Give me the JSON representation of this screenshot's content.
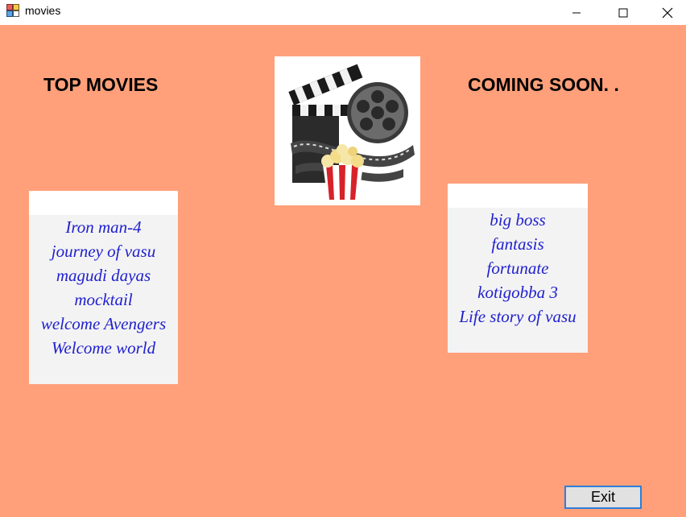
{
  "window": {
    "title": "movies",
    "icon": "app-window-icon",
    "controls": [
      "minimize-icon",
      "maximize-icon",
      "close-icon"
    ]
  },
  "headings": {
    "top_movies": "TOP MOVIES",
    "coming_soon": "COMING SOON. ."
  },
  "poster": {
    "icon": "movie-clapperboard-popcorn-icon"
  },
  "top_movies_list": {
    "items": [
      "Iron man-4",
      "journey of vasu",
      "magudi dayas",
      "mocktail",
      "welcome Avengers",
      "Welcome world"
    ]
  },
  "coming_soon_list": {
    "items": [
      "big boss",
      "fantasis",
      "fortunate",
      "kotigobba 3",
      "Life story of vasu"
    ]
  },
  "buttons": {
    "exit_label": "Exit"
  },
  "colors": {
    "form_background": "#FFA07A",
    "list_text": "#2020D0",
    "exit_border": "#2F7ED8"
  }
}
